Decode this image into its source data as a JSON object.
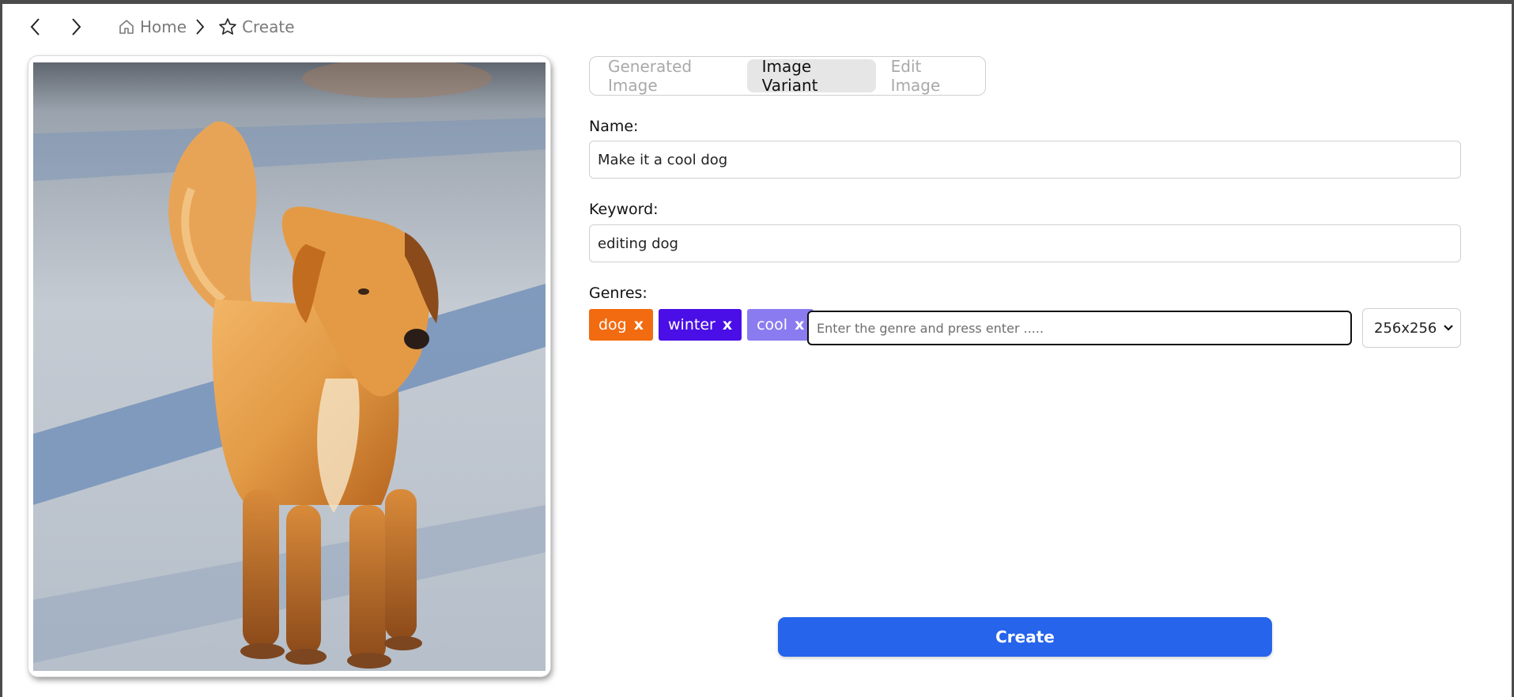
{
  "breadcrumb": {
    "home_label": "Home",
    "create_label": "Create"
  },
  "tabs": [
    {
      "label": "Generated Image",
      "active": false
    },
    {
      "label": "Image Variant",
      "active": true
    },
    {
      "label": "Edit Image",
      "active": false
    }
  ],
  "form": {
    "name_label": "Name:",
    "name_value": "Make it a cool dog",
    "keyword_label": "Keyword:",
    "keyword_value": "editing dog",
    "genres_label": "Genres:",
    "genres": [
      {
        "label": "dog",
        "remove": "x",
        "color": "#f26b10"
      },
      {
        "label": "winter",
        "remove": "x",
        "color": "#4a0fe6"
      },
      {
        "label": "cool",
        "remove": "x",
        "color": "#8a7cf0"
      }
    ],
    "genre_placeholder": "Enter the genre and press enter .....",
    "size_value": "256x256",
    "create_label": "Create"
  },
  "colors": {
    "accent": "#2564eb"
  }
}
